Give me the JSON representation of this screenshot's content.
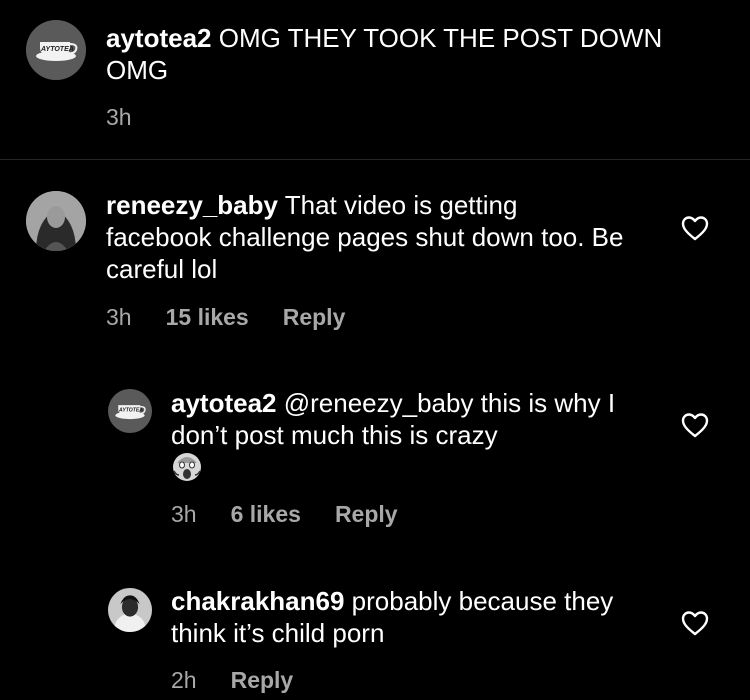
{
  "comments": [
    {
      "username": "aytotea2",
      "text": " OMG THEY TOOK THE POST DOWN OMG",
      "time": "3h",
      "avatar": "aytotea-logo"
    },
    {
      "username": "reneezy_baby",
      "text": " That video is getting facebook challenge pages shut down too. Be careful lol",
      "time": "3h",
      "likes": "15 likes",
      "reply": "Reply",
      "avatar": "profile-photo"
    },
    {
      "username": "aytotea2",
      "text": " @reneezy_baby this is why I don’t post much this is crazy",
      "emoji": "screaming-face",
      "time": "3h",
      "likes": "6 likes",
      "reply": "Reply",
      "avatar": "aytotea-logo"
    },
    {
      "username": "chakrakhan69",
      "text": " probably because they think it’s child porn",
      "time": "2h",
      "reply": "Reply",
      "avatar": "profile-photo"
    }
  ],
  "avatar_logo_text": "AYTOTEA",
  "colors": {
    "background": "#000000",
    "text": "#ffffff",
    "meta": "#a8a8a8",
    "divider": "#262626"
  }
}
